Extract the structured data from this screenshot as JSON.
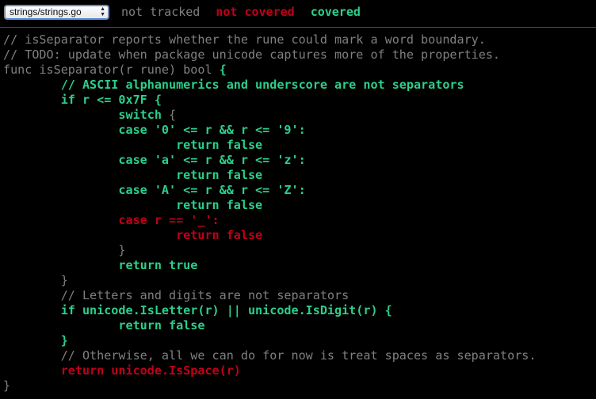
{
  "toolbar": {
    "file_select": {
      "selected": "strings/strings.go"
    },
    "legend": {
      "not_tracked": "not tracked",
      "not_covered": "not covered",
      "covered": "covered"
    }
  },
  "colors": {
    "background": "#000000",
    "not_tracked": "#808080",
    "not_covered": "#c0001a",
    "covered": "#2ccf8c"
  },
  "code": {
    "lines": [
      [
        {
          "text": "// isSeparator reports whether the rune could mark a word boundary.",
          "status": "untracked"
        }
      ],
      [
        {
          "text": "// TODO: update when package unicode captures more of the properties.",
          "status": "untracked"
        }
      ],
      [
        {
          "text": "func isSeparator(r rune) bool ",
          "status": "untracked"
        },
        {
          "text": "{",
          "status": "covered"
        }
      ],
      [
        {
          "text": "        // ASCII alphanumerics and underscore are not separators",
          "status": "covered"
        }
      ],
      [
        {
          "text": "        if r <= 0x7F {",
          "status": "covered"
        }
      ],
      [
        {
          "text": "                switch ",
          "status": "covered"
        },
        {
          "text": "{",
          "status": "untracked"
        }
      ],
      [
        {
          "text": "                case '0' <= r && r <= '9':",
          "status": "covered"
        }
      ],
      [
        {
          "text": "                        return false",
          "status": "covered"
        }
      ],
      [
        {
          "text": "                case 'a' <= r && r <= 'z':",
          "status": "covered"
        }
      ],
      [
        {
          "text": "                        return false",
          "status": "covered"
        }
      ],
      [
        {
          "text": "                case 'A' <= r && r <= 'Z':",
          "status": "covered"
        }
      ],
      [
        {
          "text": "                        return false",
          "status": "covered"
        }
      ],
      [
        {
          "text": "                case r == '_':",
          "status": "notcovered"
        }
      ],
      [
        {
          "text": "                        return false",
          "status": "notcovered"
        }
      ],
      [
        {
          "text": "                }",
          "status": "untracked"
        }
      ],
      [
        {
          "text": "                return true",
          "status": "covered"
        }
      ],
      [
        {
          "text": "        }",
          "status": "untracked"
        }
      ],
      [
        {
          "text": "        // Letters and digits are not separators",
          "status": "untracked"
        }
      ],
      [
        {
          "text": "        if unicode.IsLetter(r) || unicode.IsDigit(r) {",
          "status": "covered"
        }
      ],
      [
        {
          "text": "                return false",
          "status": "covered"
        }
      ],
      [
        {
          "text": "        }",
          "status": "covered"
        }
      ],
      [
        {
          "text": "        // Otherwise, all we can do for now is treat spaces as separators.",
          "status": "untracked"
        }
      ],
      [
        {
          "text": "        return unicode.IsSpace(r)",
          "status": "notcovered"
        }
      ],
      [
        {
          "text": "}",
          "status": "untracked"
        }
      ]
    ]
  }
}
